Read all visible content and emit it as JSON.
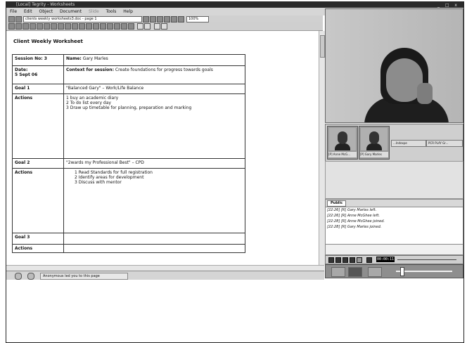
{
  "window": {
    "title": "[Local] Tegrity - Worksheets",
    "controls": "_ □ x"
  },
  "menu": [
    "File",
    "Edit",
    "Object",
    "Document",
    "Slide",
    "Tools",
    "Help"
  ],
  "toolbar": {
    "doc_combo": "clients weekly worksheets3.doc - page 1",
    "zoom": "100%"
  },
  "document": {
    "title": "Client Weekly Worksheet",
    "rows": [
      {
        "label": "Session No: 3",
        "content_label": "Name:",
        "content": "Gary Marles"
      },
      {
        "label": "Date:",
        "label2": "5 Sept 06",
        "content_label": "Context for session:",
        "content": "Create foundations for progress towards goals"
      },
      {
        "label": "Goal 1",
        "content": "\"Balanced Gary\" – Work/Life Balance"
      },
      {
        "label": "Actions",
        "items": [
          "1  buy an academic diary",
          "2  To do list every day",
          "3  Draw up timetable for planning, preparation and marking"
        ]
      },
      {
        "label": "Goal 2",
        "content": "\"2wards my Professional Best\" – CPD"
      },
      {
        "label": "Actions",
        "items": [
          "1   Read Standards for full registration",
          "2   Identify areas for development",
          "3   Discuss with mentor"
        ]
      },
      {
        "label": "Goal 3",
        "content": ""
      },
      {
        "label": "Actions",
        "content": ""
      }
    ]
  },
  "status": {
    "message": "Anonymous led you to this page"
  },
  "participants": {
    "cards": [
      {
        "name": "[P] Anne McG..."
      },
      {
        "name": "[P] Gary Marles"
      }
    ],
    "slots": [
      "...Indexpe",
      "PCR PLAY Gr..."
    ]
  },
  "chat": {
    "tab": "Public",
    "log": [
      "[22:26] [R] Gary Marles left.",
      "[22:26] [R] Anne McGhee left.",
      "[22:28] [R] Anne McGhee joined.",
      "[22:28] [R] Gary Marles joined."
    ]
  },
  "player": {
    "time": "00:00:11"
  }
}
